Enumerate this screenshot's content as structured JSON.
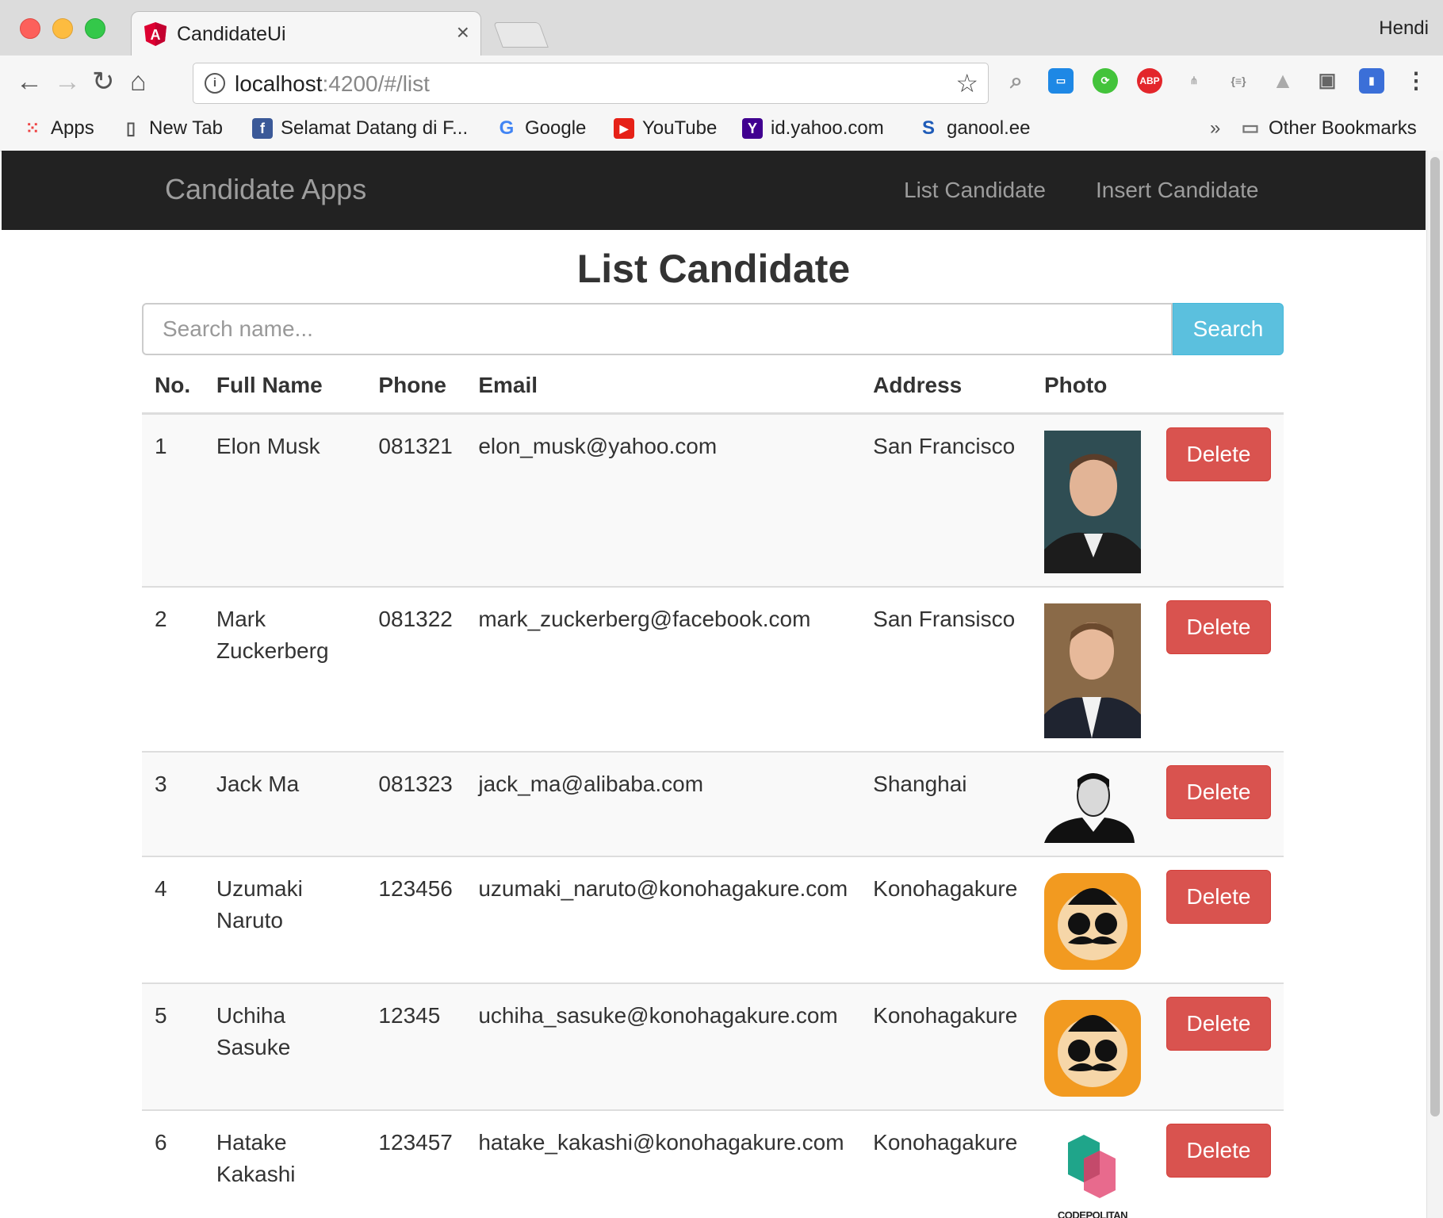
{
  "browser": {
    "tab_title": "CandidateUi",
    "profile_name": "Hendi",
    "url_host": "localhost",
    "url_path": ":4200/#/list",
    "bookmarks": [
      {
        "label": "Apps",
        "icon": "apps-grid-icon"
      },
      {
        "label": "New Tab",
        "icon": "page-icon"
      },
      {
        "label": "Selamat Datang di F...",
        "icon": "facebook-icon"
      },
      {
        "label": "Google",
        "icon": "google-icon"
      },
      {
        "label": "YouTube",
        "icon": "youtube-icon"
      },
      {
        "label": "id.yahoo.com",
        "icon": "yahoo-icon"
      },
      {
        "label": "ganool.ee",
        "icon": "ganool-icon"
      }
    ],
    "more_bookmarks": "»",
    "other_bookmarks": "Other Bookmarks"
  },
  "navbar": {
    "brand": "Candidate Apps",
    "links": [
      "List Candidate",
      "Insert Candidate"
    ]
  },
  "page": {
    "title": "List Candidate",
    "search_placeholder": "Search name...",
    "search_button": "Search"
  },
  "table": {
    "headers": [
      "No.",
      "Full Name",
      "Phone",
      "Email",
      "Address",
      "Photo"
    ],
    "delete_label": "Delete",
    "rows": [
      {
        "no": "1",
        "name": "Elon Musk",
        "phone": "081321",
        "email": "elon_musk@yahoo.com",
        "address": "San Francisco",
        "photo": "portrait-photo"
      },
      {
        "no": "2",
        "name": "Mark Zuckerberg",
        "phone": "081322",
        "email": "mark_zuckerberg@facebook.com",
        "address": "San Fransisco",
        "photo": "portrait-photo"
      },
      {
        "no": "3",
        "name": "Jack Ma",
        "phone": "081323",
        "email": "jack_ma@alibaba.com",
        "address": "Shanghai",
        "photo": "bw-portrait-photo"
      },
      {
        "no": "4",
        "name": "Uzumaki Naruto",
        "phone": "123456",
        "email": "uzumaki_naruto@konohagakure.com",
        "address": "Konohagakure",
        "photo": "mustache-avatar-icon"
      },
      {
        "no": "5",
        "name": "Uchiha Sasuke",
        "phone": "12345",
        "email": "uchiha_sasuke@konohagakure.com",
        "address": "Konohagakure",
        "photo": "mustache-avatar-icon"
      },
      {
        "no": "6",
        "name": "Hatake Kakashi",
        "phone": "123457",
        "email": "hatake_kakashi@konohagakure.com",
        "address": "Konohagakure",
        "photo": "codepolitan-logo",
        "photo_caption": "CODEPOLITAN"
      }
    ]
  },
  "colors": {
    "navbar_bg": "#222222",
    "search_button": "#5bc0de",
    "delete_button": "#d9534f"
  }
}
